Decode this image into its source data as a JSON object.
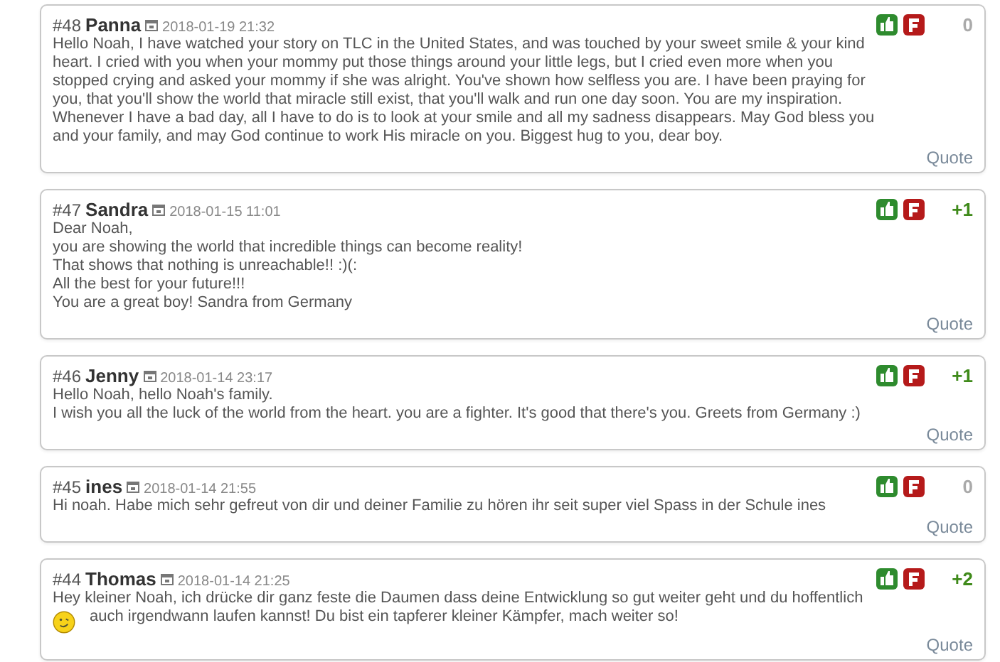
{
  "comments": [
    {
      "number": "#48",
      "author": "Panna",
      "date": "2018-01-19 21:32",
      "score": "0",
      "color": "#aaaaaa",
      "emoticon": false,
      "lines": [
        "Hello Noah, I have watched your story on TLC in the United States, and was touched by your sweet smile & your kind",
        "heart. I cried with you when your mommy put those things around your little legs, but I cried even more when you",
        "stopped crying and asked your mommy if she was alright. You've shown how selfless you are. I have been praying for",
        "you, that you'll show the world that miracle still exist, that you'll walk and run one day soon. You are my inspiration.",
        "Whenever I have a bad day, all I have to do is to look at your smile and all my sadness disappears. May God bless you",
        "and your family, and may God continue to work His miracle on you. Biggest hug to you, dear boy."
      ],
      "quote": "Quote"
    },
    {
      "number": "#47",
      "author": "Sandra",
      "date": "2018-01-15 11:01",
      "score": "+1",
      "color": "#3f8a1a",
      "emoticon": false,
      "lines": [
        "Dear Noah,",
        "you are showing the world that incredible things can become reality!",
        "That shows that nothing is unreachable!! :)(:",
        "All the best for your future!!!",
        "You are a great boy! Sandra from Germany"
      ],
      "quote": "Quote"
    },
    {
      "number": "#46",
      "author": "Jenny",
      "date": "2018-01-14 23:17",
      "score": "+1",
      "color": "#3f8a1a",
      "emoticon": false,
      "lines": [
        "Hello Noah, hello Noah's family.",
        "I wish you all the luck of the world from the heart. you are a fighter. It's good that there's you. Greets from Germany :)"
      ],
      "quote": "Quote"
    },
    {
      "number": "#45",
      "author": "ines",
      "date": "2018-01-14 21:55",
      "score": "0",
      "color": "#aaaaaa",
      "emoticon": false,
      "lines": [
        "Hi noah. Habe mich sehr gefreut von dir und deiner Familie zu hören ihr seit super viel Spass in der Schule ines"
      ],
      "quote": "Quote"
    },
    {
      "number": "#44",
      "author": "Thomas",
      "date": "2018-01-14 21:25",
      "score": "+2",
      "color": "#3f8a1a",
      "emoticon": true,
      "lines": [
        "Hey kleiner Noah, ich drücke dir ganz feste die Daumen dass deine Entwicklung so gut weiter geht und du hoffentlich",
        "auch irgendwann laufen kannst! Du bist ein tapferer kleiner Kämpfer, mach weiter so!"
      ],
      "quote": "Quote"
    }
  ]
}
